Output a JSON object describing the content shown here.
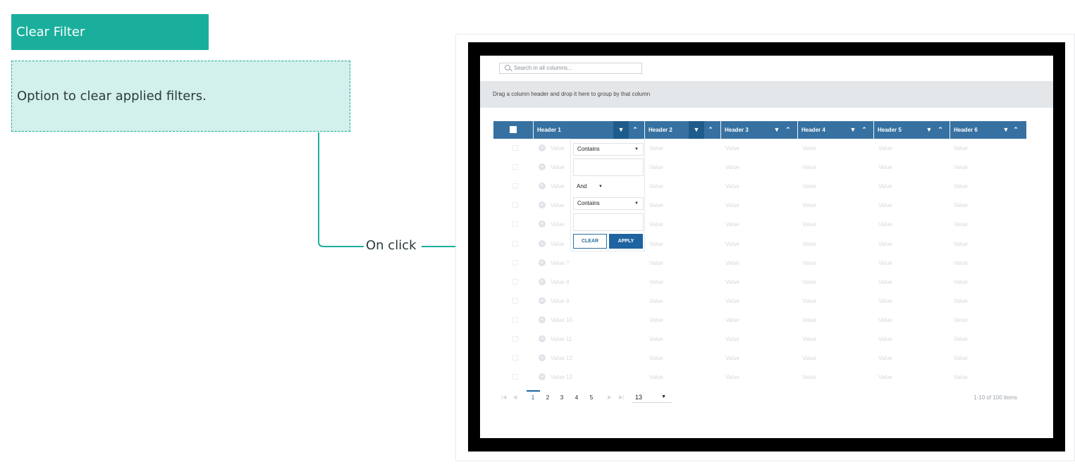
{
  "annotation": {
    "title": "Clear Filter",
    "description": "Option to clear applied filters.",
    "trigger_label": "On click",
    "accent_color": "#1aaf9c"
  },
  "grid": {
    "search_placeholder": "Search in all columns...",
    "group_hint": "Drag a column header and drop it here to group by that column",
    "headers": [
      "Header 1",
      "Header 2",
      "Header 3",
      "Header 4",
      "Header 5",
      "Header 6"
    ],
    "filter_icon": "filter-icon",
    "sort_icon": "sort-icon",
    "header_color": "#3671a1",
    "rows": [
      {
        "first": "Value",
        "rest": [
          "Value",
          "Value",
          "Value",
          "Value",
          "Value"
        ]
      },
      {
        "first": "Value",
        "rest": [
          "Value",
          "Value",
          "Value",
          "Value",
          "Value"
        ]
      },
      {
        "first": "Value",
        "rest": [
          "Value",
          "Value",
          "Value",
          "Value",
          "Value"
        ]
      },
      {
        "first": "Value",
        "rest": [
          "Value",
          "Value",
          "Value",
          "Value",
          "Value"
        ]
      },
      {
        "first": "Value",
        "rest": [
          "Value",
          "Value",
          "Value",
          "Value",
          "Value"
        ]
      },
      {
        "first": "Value",
        "rest": [
          "Value",
          "Value",
          "Value",
          "Value",
          "Value"
        ]
      },
      {
        "first": "Value 7",
        "rest": [
          "Value",
          "Value",
          "Value",
          "Value",
          "Value"
        ]
      },
      {
        "first": "Value 8",
        "rest": [
          "Value",
          "Value",
          "Value",
          "Value",
          "Value"
        ]
      },
      {
        "first": "Value 9",
        "rest": [
          "Value",
          "Value",
          "Value",
          "Value",
          "Value"
        ]
      },
      {
        "first": "Value 10",
        "rest": [
          "Value",
          "Value",
          "Value",
          "Value",
          "Value"
        ]
      },
      {
        "first": "Value 11",
        "rest": [
          "Value",
          "Value",
          "Value",
          "Value",
          "Value"
        ]
      },
      {
        "first": "Value 12",
        "rest": [
          "Value",
          "Value",
          "Value",
          "Value",
          "Value"
        ]
      },
      {
        "first": "Value 13",
        "rest": [
          "Value",
          "Value",
          "Value",
          "Value",
          "Value"
        ]
      }
    ]
  },
  "filter_popup": {
    "operator1": "Contains",
    "logic": "And",
    "operator2": "Contains",
    "value1": "",
    "value2": "",
    "clear_label": "CLEAR",
    "apply_label": "APPLY"
  },
  "pagination": {
    "pages": [
      "1",
      "2",
      "3",
      "4",
      "5"
    ],
    "current_page": "1",
    "page_size": "13",
    "info": "1-10 of 100 items"
  }
}
